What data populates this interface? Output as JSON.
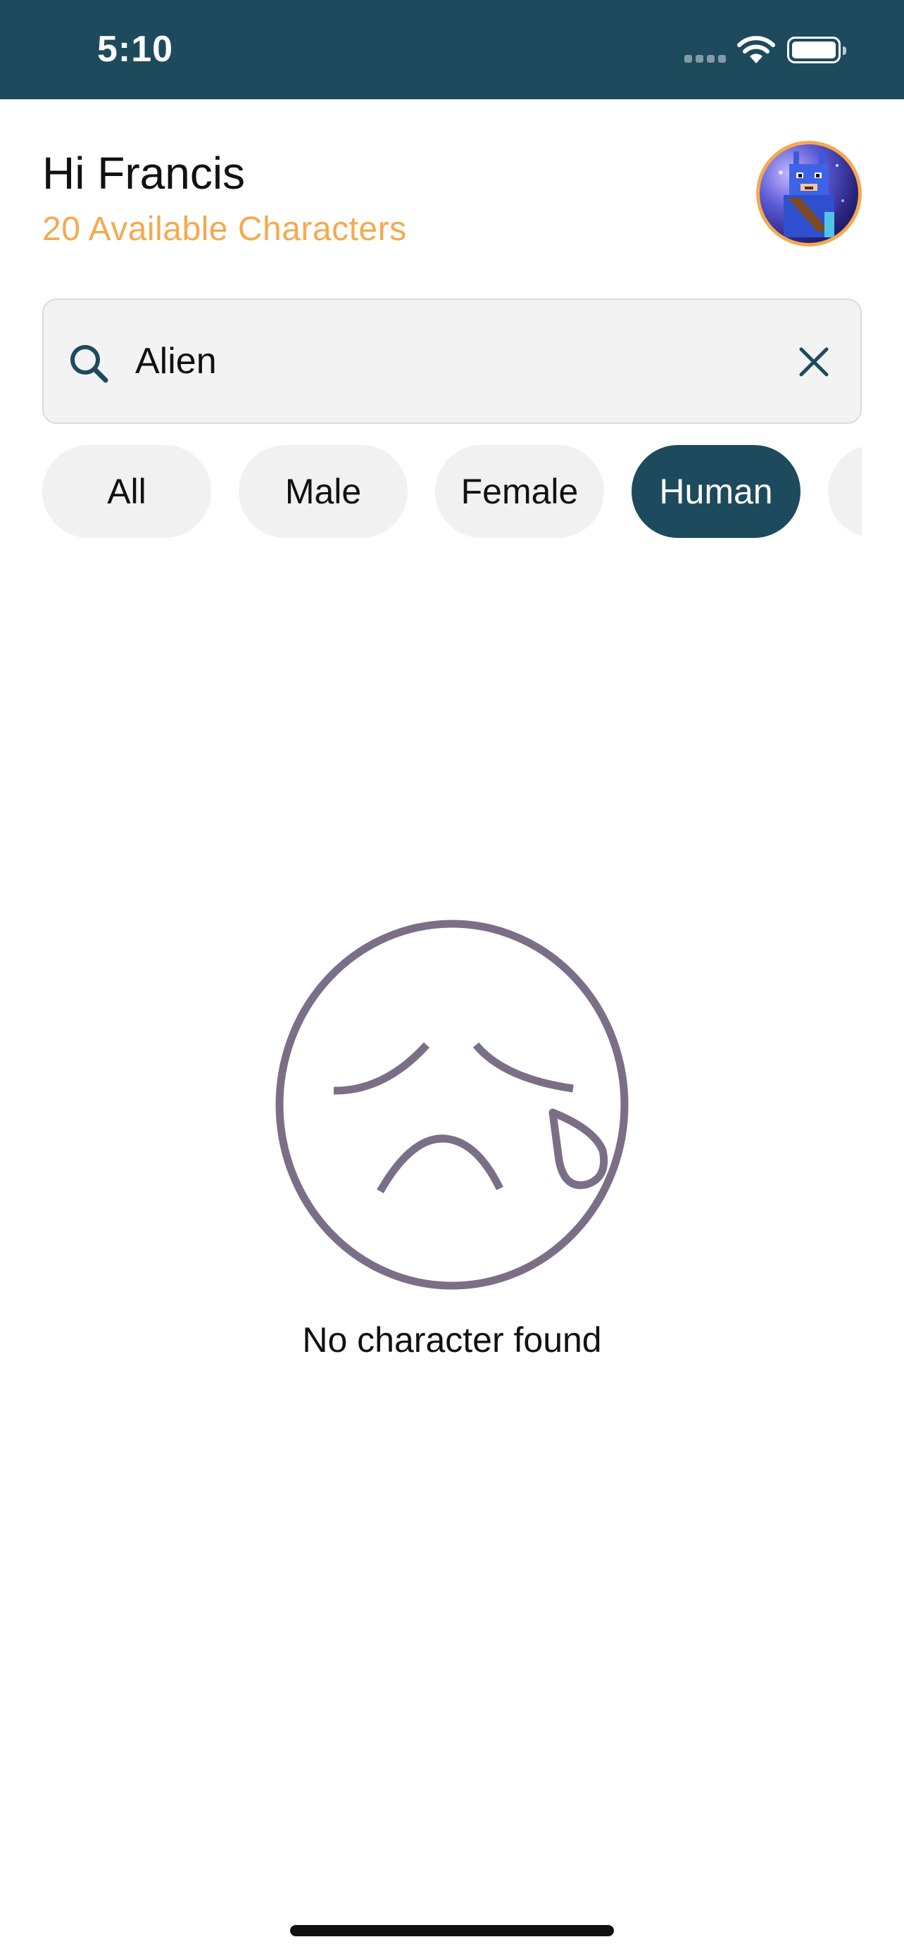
{
  "status_bar": {
    "time": "5:10"
  },
  "header": {
    "greeting": "Hi Francis",
    "subtitle": "20 Available Characters",
    "avatar_icon": "profile-avatar-icon"
  },
  "search": {
    "value": "Alien",
    "icon": "search-icon",
    "clear_icon": "close-icon"
  },
  "filters": {
    "chips": [
      {
        "label": "All",
        "selected": false
      },
      {
        "label": "Male",
        "selected": false
      },
      {
        "label": "Female",
        "selected": false
      },
      {
        "label": "Human",
        "selected": true
      }
    ]
  },
  "empty_state": {
    "icon": "sad-face-icon",
    "message": "No character found"
  },
  "colors": {
    "primary": "#1e4a5d",
    "accent": "#f5a94f",
    "chip_bg": "#f1f1f1",
    "empty_icon": "#7b6f87"
  }
}
